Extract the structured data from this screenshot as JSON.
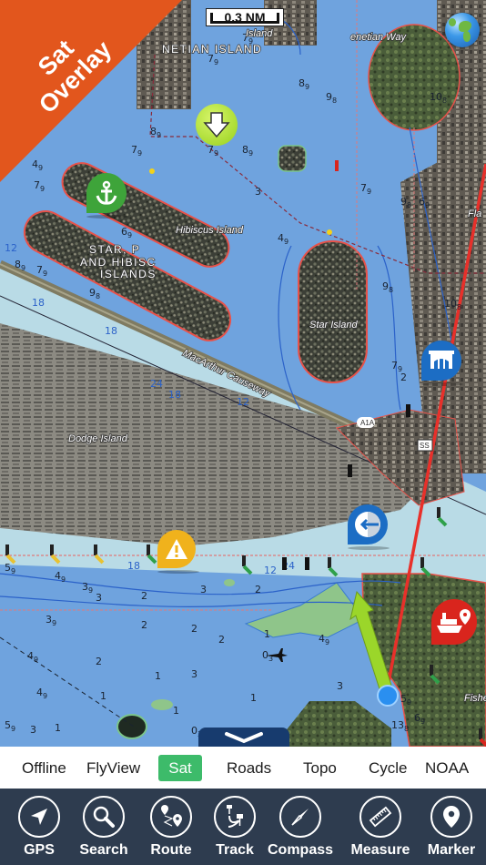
{
  "map": {
    "scale_label": "0.3 NM",
    "banner_lines": [
      "Sat",
      "Overlay"
    ],
    "place_labels": {
      "venetian_islands": "NETIAN ISLAND",
      "island_top": "Island",
      "venetian_way": "enetian Way",
      "hibiscus_island": "Hibiscus Island",
      "star_palm_hibiscus": [
        "STAR, P",
        "AND HIBISC",
        "ISLANDS"
      ],
      "star_island": "Star Island",
      "macarthur_causeway": "MacArthur Causeway",
      "dodge_island": "Dodge Island",
      "route_a1a": "A1A",
      "shield_ss": "SS",
      "fisher": "Fishe",
      "flam": "Fla"
    },
    "soundings": [
      {
        "v": "8",
        "s": "9"
      },
      {
        "v": "7",
        "s": "9"
      },
      {
        "v": "8",
        "s": "9"
      },
      {
        "v": "7",
        "s": "9"
      },
      {
        "v": "6",
        "s": "9"
      },
      {
        "v": "4",
        "s": "9"
      },
      {
        "v": "7",
        "s": "9"
      },
      {
        "v": "6",
        "s": "9"
      },
      {
        "v": "9",
        "s": "8"
      },
      {
        "v": "10",
        "s": "8"
      },
      {
        "v": "8",
        "s": "9"
      },
      {
        "v": "5",
        "s": "9"
      },
      {
        "v": "3",
        "s": ""
      },
      {
        "v": "9",
        "s": "8"
      },
      {
        "v": "7",
        "s": "9"
      },
      {
        "v": "2",
        "s": ""
      },
      {
        "v": "3",
        "s": ""
      },
      {
        "v": "1",
        "s": ""
      },
      {
        "v": "0",
        "s": "3"
      },
      {
        "v": "13",
        "s": "8"
      }
    ],
    "contour_labels": [
      "12",
      "18",
      "24",
      "6"
    ],
    "poi_markers": [
      "anchorage",
      "bridge",
      "warning",
      "exit",
      "ship-marina",
      "download"
    ]
  },
  "layers": {
    "tabs": [
      {
        "label": "Offline",
        "active": false
      },
      {
        "label": "FlyView",
        "active": false
      },
      {
        "label": "Sat",
        "active": true
      },
      {
        "label": "Roads",
        "active": false
      },
      {
        "label": "Topo",
        "active": false
      },
      {
        "label": "Cycle",
        "active": false
      },
      {
        "label": "NOAA",
        "active": false
      }
    ]
  },
  "toolbar": {
    "items": [
      {
        "label": "GPS",
        "icon": "navigation-arrow-icon"
      },
      {
        "label": "Search",
        "icon": "search-icon"
      },
      {
        "label": "Route",
        "icon": "route-icon"
      },
      {
        "label": "Track",
        "icon": "track-icon"
      },
      {
        "label": "Compass",
        "icon": "compass-icon"
      },
      {
        "label": "Measure",
        "icon": "ruler-icon"
      },
      {
        "label": "Marker",
        "icon": "map-pin-icon"
      }
    ]
  },
  "colors": {
    "water": "#6fa3de",
    "channel": "#b9dbe6",
    "banner": "#e2561d",
    "active_tab": "#3dbb6a",
    "toolbar_bg": "#2e3c4f",
    "route_line": "#e8302a",
    "heading_arrow": "#9bd62a"
  }
}
